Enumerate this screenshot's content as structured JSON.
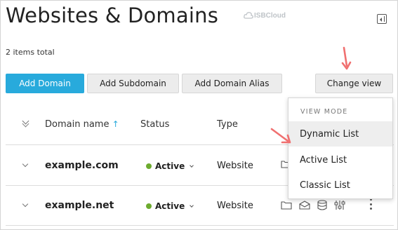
{
  "page": {
    "title": "Websites & Domains",
    "watermark": "ISBCloud",
    "items_total": "2 items total"
  },
  "toolbar": {
    "add_domain": "Add Domain",
    "add_subdomain": "Add Subdomain",
    "add_domain_alias": "Add Domain Alias",
    "change_view": "Change view"
  },
  "table": {
    "columns": {
      "domain_name": "Domain name",
      "sort_indicator": "↑",
      "status": "Status",
      "type": "Type"
    },
    "rows": [
      {
        "domain": "example.com",
        "status": "Active",
        "type": "Website"
      },
      {
        "domain": "example.net",
        "status": "Active",
        "type": "Website"
      }
    ]
  },
  "view_menu": {
    "header": "VIEW MODE",
    "items": [
      {
        "label": "Dynamic List",
        "selected": true
      },
      {
        "label": "Active List",
        "selected": false
      },
      {
        "label": "Classic List",
        "selected": false
      }
    ]
  },
  "colors": {
    "primary": "#28aadc",
    "active_status": "#6dab2f",
    "annotation_arrow": "#f07070"
  },
  "icons": [
    "panel-toggle-icon",
    "expand-chevron-icon",
    "folder-icon",
    "mail-icon",
    "database-icon",
    "settings-sliders-icon",
    "more-options-icon",
    "annotation-arrow-icon"
  ]
}
